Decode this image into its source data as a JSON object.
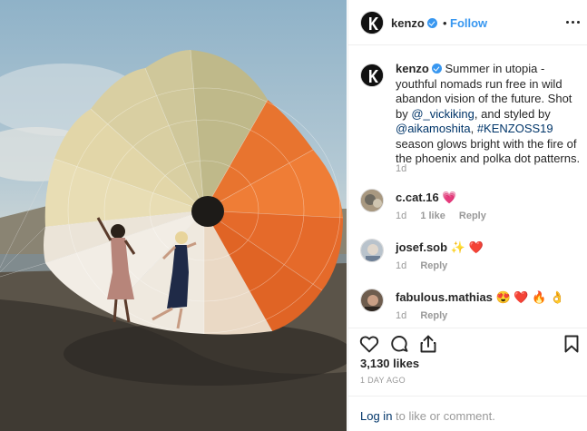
{
  "post": {
    "username": "kenzo",
    "dot": "•",
    "follow_label": "Follow"
  },
  "caption": {
    "username": "kenzo",
    "text_1": "Summer in utopia - youthful nomads run free in wild abandon vision of the future. Shot by ",
    "mention_1": "@_vickiking",
    "text_2": ", and styled by ",
    "mention_2": "@aikamoshita",
    "text_3": ", ",
    "hashtag": "#KENZOSS19",
    "text_4": " season glows bright with the fire of the phoenix and polka dot patterns.",
    "time": "1d"
  },
  "comments": [
    {
      "username": "c.cat.16",
      "text": "💗",
      "time": "1d",
      "likes": "1 like",
      "reply": "Reply"
    },
    {
      "username": "josef.sob",
      "text": "✨ ❤️",
      "time": "1d",
      "reply": "Reply"
    },
    {
      "username": "fabulous.mathias",
      "text": "😍 ❤️ 🔥 👌",
      "time": "1d",
      "reply": "Reply"
    }
  ],
  "actions": {
    "likes": "3,130 likes",
    "ago": "1 DAY AGO",
    "login_link": "Log in",
    "login_rest": " to like or comment."
  },
  "colors": {
    "accent": "#3897f0",
    "link": "#003569",
    "muted": "#999999"
  },
  "icons": [
    "heart-icon",
    "comment-icon",
    "share-icon",
    "bookmark-icon",
    "more-options-icon",
    "verified-badge-icon"
  ]
}
